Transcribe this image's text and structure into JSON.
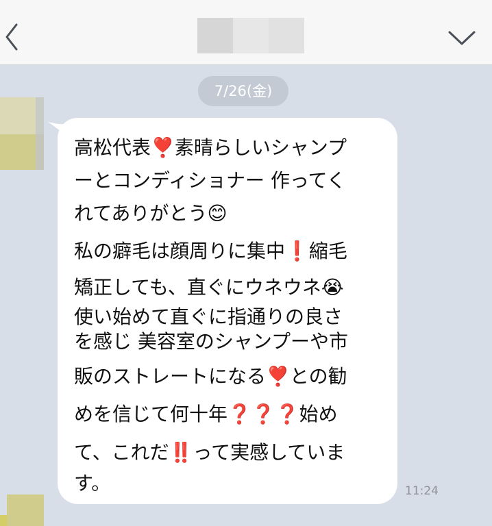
{
  "header": {
    "back_icon": "chevron-left-icon",
    "menu_icon": "chevron-down-icon",
    "title_blur_colors": [
      "#d6d6d6",
      "#e7e7e7",
      "#e1e1e1"
    ]
  },
  "date_separator": "7/26(金)",
  "message": {
    "lines": [
      "高松代表❣️素晴らしいシャンプ",
      "ーとコンディショナー 作ってく",
      "れてありがとう😊",
      "私の癖毛は顔周りに集中❗️縮毛",
      "矯正しても、直ぐにウネウネ😭",
      "使い始めて直ぐに指通りの良さ",
      "を感じ 美容室のシャンプーや市",
      "販のストレートになる❣️との勧",
      "めを信じて何十年❓❓❓始め",
      "て、これだ‼️って実感していま",
      "す。"
    ],
    "time": "11:24"
  },
  "colors": {
    "chat_background": "#d8dee8",
    "bubble": "#ffffff",
    "date_pill": "#c4cad4",
    "header_background": "#f7f7f8",
    "icon": "#4a4f58"
  }
}
